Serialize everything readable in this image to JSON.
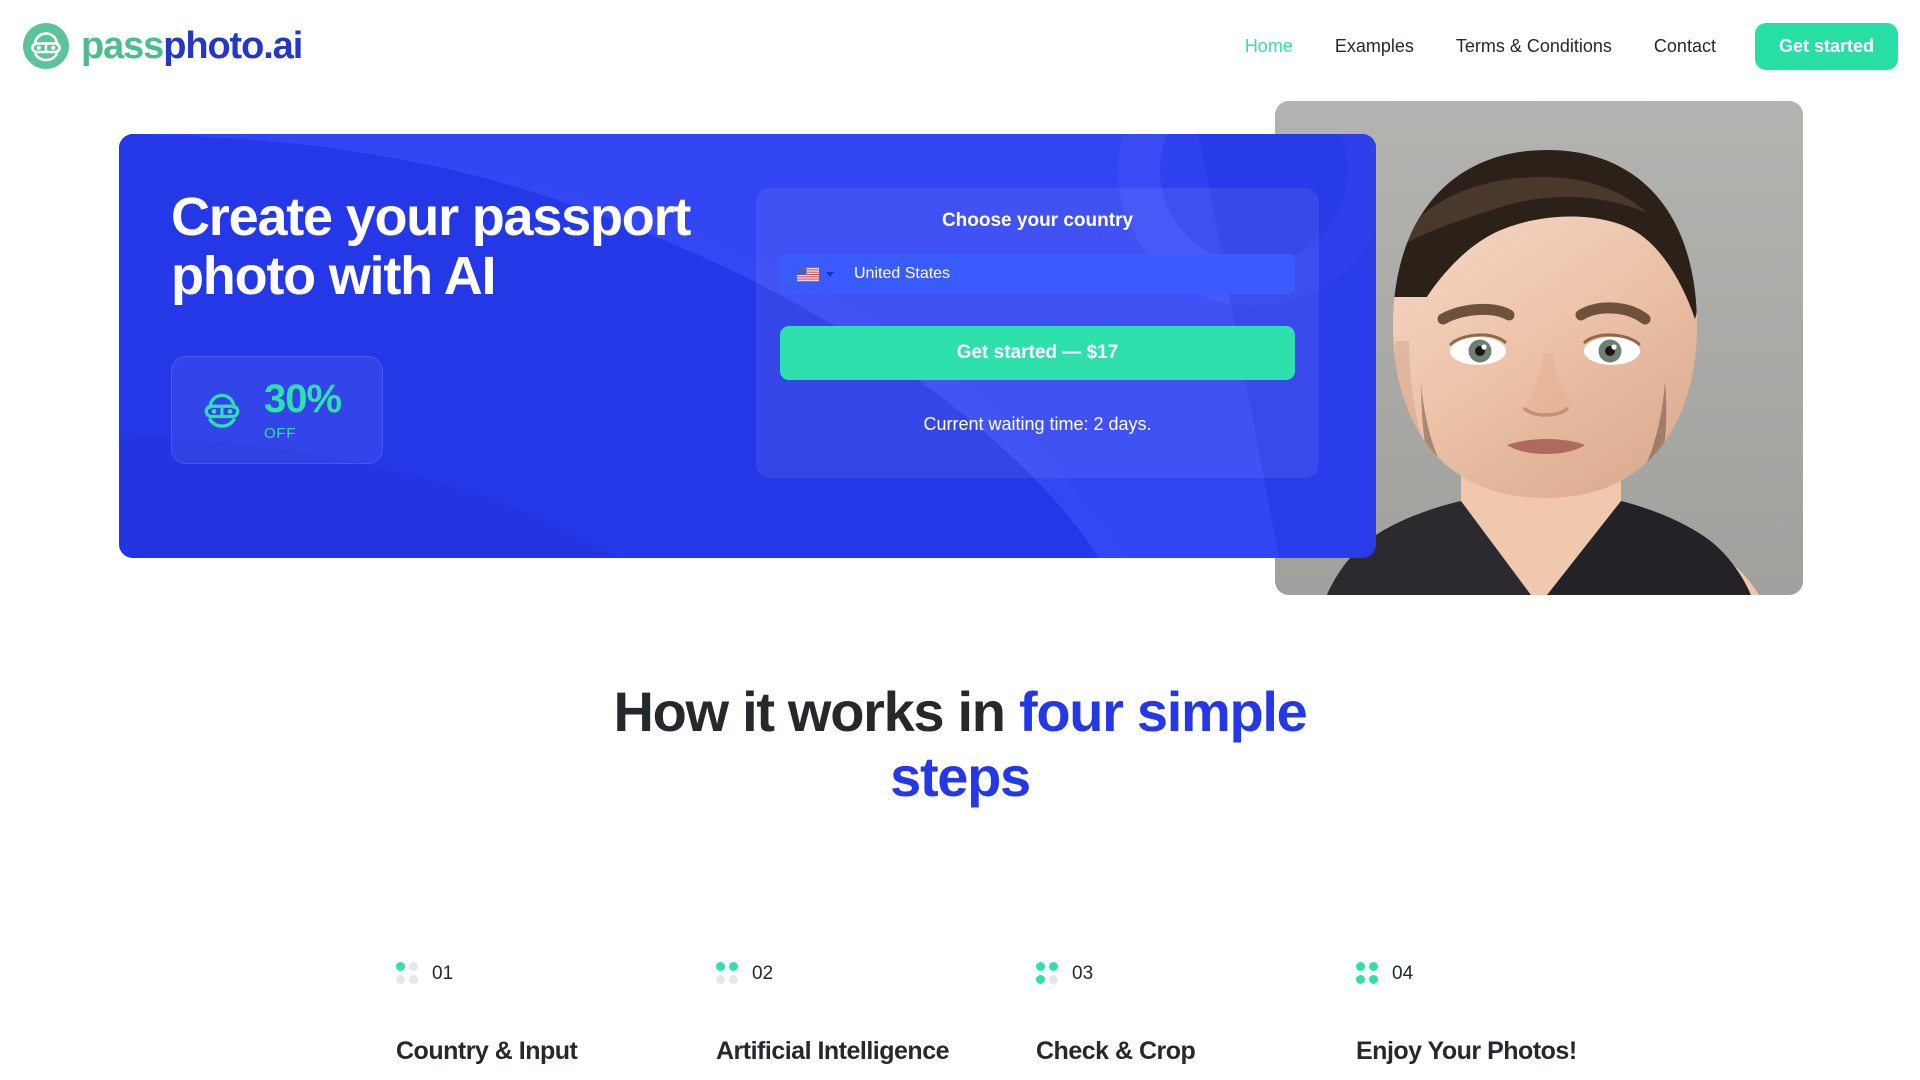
{
  "brand": {
    "name_part1": "pass",
    "name_part2": "photo.ai",
    "logo_icon": "face-with-glasses-icon",
    "color_green": "#4cbd8c",
    "color_blue": "#2438c4"
  },
  "nav": {
    "links": [
      {
        "label": "Home",
        "active": true
      },
      {
        "label": "Examples",
        "active": false
      },
      {
        "label": "Terms & Conditions",
        "active": false
      },
      {
        "label": "Contact",
        "active": false
      }
    ],
    "cta_label": "Get started",
    "cta_color": "#27dea4",
    "active_color": "#2ee0ac"
  },
  "hero": {
    "title": "Create your passport\nphoto with AI",
    "panel_color": "#2538e8",
    "badge": {
      "icon": "face-with-glasses-icon",
      "percent": "30%",
      "suffix": "OFF",
      "accent_color": "#2ee0ac"
    },
    "photo": {
      "alt": "passport-photo-portrait",
      "background_color": "#a9a9a6"
    },
    "country_card": {
      "title": "Choose your country",
      "flag_icon": "flag-united-states-icon",
      "caret_icon": "chevron-down-icon",
      "selected_country": "United States",
      "cta_label": "Get started — $17",
      "cta_color": "#2ee0ac",
      "waiting_time": "Current waiting time: 2 days."
    }
  },
  "how_it_works": {
    "title_plain": "How it works in ",
    "title_accent": "four simple steps",
    "accent_color": "#2538e8",
    "steps": [
      {
        "number": "01",
        "name": "Country & Input",
        "filled_dots": 1
      },
      {
        "number": "02",
        "name": "Artificial Intelligence",
        "filled_dots": 2
      },
      {
        "number": "03",
        "name": "Check & Crop",
        "filled_dots": 3
      },
      {
        "number": "04",
        "name": "Enjoy Your Photos!",
        "filled_dots": 4
      }
    ],
    "dot_on_color": "#2ee0ac",
    "dot_off_color": "#e4e7ea"
  }
}
